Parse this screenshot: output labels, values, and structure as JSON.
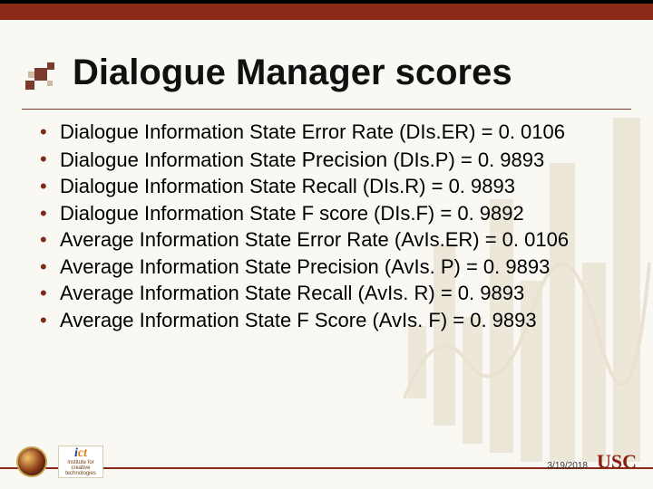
{
  "title": "Dialogue Manager scores",
  "bullets": [
    "Dialogue Information State Error Rate (DIs.ER) = 0. 0106",
    "Dialogue Information State Precision (DIs.P) = 0. 9893",
    "Dialogue Information State Recall (DIs.R) = 0. 9893",
    "Dialogue Information State F score (DIs.F) = 0. 9892",
    "Average Information State Error Rate (AvIs.ER) = 0. 0106",
    "Average Information State Precision (AvIs. P) = 0. 9893",
    "Average Information State Recall (AvIs. R) = 0. 9893",
    "Average Information State F Score (AvIs. F) = 0. 9893"
  ],
  "footer": {
    "date": "3/19/2018",
    "usc": "USC",
    "ict_label": "ict",
    "ict_sub": "institute for creative technologies"
  }
}
